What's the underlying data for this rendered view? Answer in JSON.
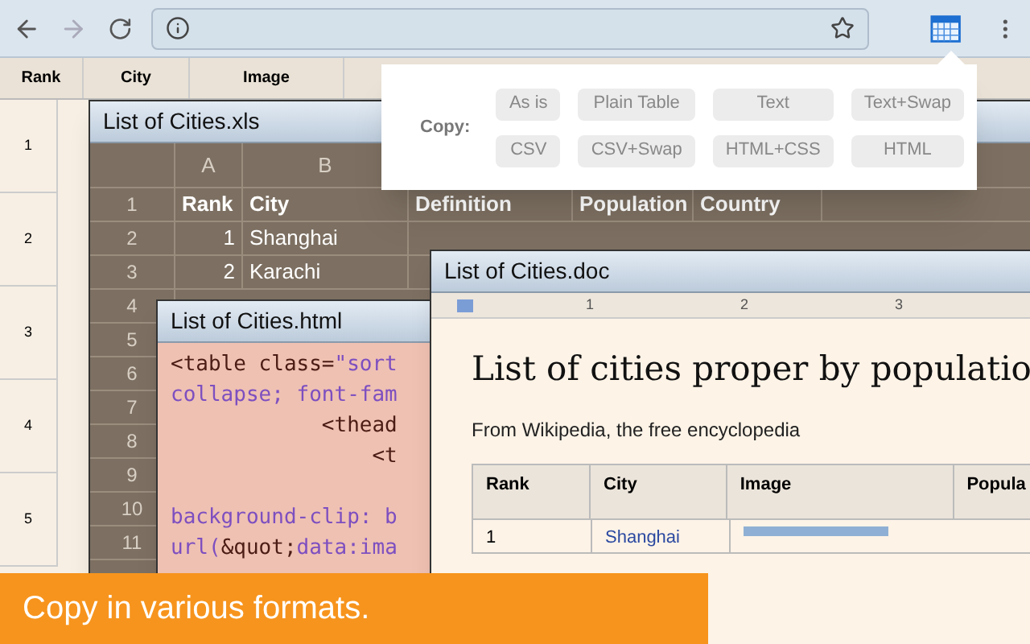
{
  "background_table": {
    "columns": [
      "Rank",
      "City",
      "Image"
    ],
    "rows": [
      "1",
      "2",
      "3",
      "4",
      "5"
    ]
  },
  "popup": {
    "label": "Copy:",
    "buttons": [
      {
        "label": "As is"
      },
      {
        "label": "Plain Table"
      },
      {
        "label": "Text"
      },
      {
        "label": "Text+Swap"
      },
      {
        "label": "CSV"
      },
      {
        "label": "CSV+Swap"
      },
      {
        "label": "HTML+CSS"
      },
      {
        "label": "HTML"
      }
    ]
  },
  "xls_window": {
    "title": "List of Cities.xls",
    "columns": [
      "A",
      "B"
    ],
    "row_numbers": [
      "1",
      "2",
      "3",
      "4",
      "5",
      "6",
      "7",
      "8",
      "9",
      "10",
      "11"
    ],
    "rows": [
      [
        "Rank",
        "City",
        "Definition",
        "Population",
        "Country"
      ],
      [
        "1",
        "Shanghai"
      ],
      [
        "2",
        "Karachi"
      ]
    ]
  },
  "html_window": {
    "title": "List of Cities.html",
    "lines": [
      [
        {
          "kind": "tag",
          "text": "<table class="
        },
        {
          "kind": "value",
          "text": "\"sort"
        }
      ],
      [
        {
          "kind": "value",
          "text": "collapse; font-fam"
        }
      ],
      [
        {
          "kind": "tag",
          "text": "            <thead"
        }
      ],
      [
        {
          "kind": "tag",
          "text": "                <t"
        }
      ],
      {
        "gap_before": true,
        "parts": [
          {
            "kind": "value",
            "text": "background-clip: b"
          }
        ]
      },
      [
        {
          "kind": "value",
          "text": "url("
        },
        {
          "kind": "tag",
          "text": "&quot;"
        },
        {
          "kind": "value",
          "text": "data:ima"
        }
      ]
    ]
  },
  "doc_window": {
    "title": "List of Cities.doc",
    "ruler": [
      "1",
      "2",
      "3"
    ],
    "heading": "List of cities proper by populatio",
    "subtitle": "From Wikipedia, the free encyclopedia",
    "table": {
      "columns": [
        "Rank",
        "City",
        "Image",
        "Popula"
      ],
      "rows": [
        [
          "1",
          "Shanghai"
        ]
      ]
    }
  },
  "banner": {
    "text": "Copy in various formats."
  }
}
